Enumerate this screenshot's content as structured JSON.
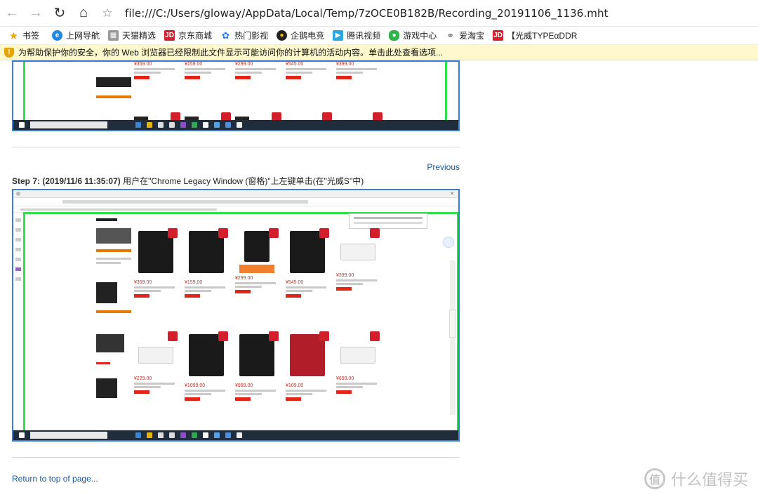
{
  "browser": {
    "url": "file:///C:/Users/gloway/AppData/Local/Temp/7zOCE0B182B/Recording_20191106_1136.mht",
    "back_icon": "back-arrow-icon",
    "forward_icon": "forward-arrow-icon",
    "refresh_icon": "refresh-icon",
    "home_icon": "home-icon",
    "favorite_icon": "star-icon"
  },
  "favorites": [
    {
      "label": "书签",
      "icon": "star-icon",
      "color": "#f2a900"
    },
    {
      "label": "上网导航",
      "icon": "ie-icon",
      "color": "#1e88e5"
    },
    {
      "label": "天猫精选",
      "icon": "tmall-icon",
      "color": "#777777"
    },
    {
      "label": "京东商城",
      "icon": "jd-icon",
      "color": "#d21f2b"
    },
    {
      "label": "热门影视",
      "icon": "paw-icon",
      "color": "#2a7be4"
    },
    {
      "label": "企鹅电竞",
      "icon": "penguin-icon",
      "color": "#222222"
    },
    {
      "label": "腾讯视频",
      "icon": "play-icon",
      "color": "#29a8e0"
    },
    {
      "label": "游戏中心",
      "icon": "gamepad-icon",
      "color": "#34b24a"
    },
    {
      "label": "爱淘宝",
      "icon": "globe-icon",
      "color": "#666666"
    },
    {
      "label": "【光威TYPEαDDR",
      "icon": "jd-icon",
      "color": "#d21f2b"
    }
  ],
  "infobar": {
    "text": "为帮助保护你的安全，你的 Web 浏览器已经限制此文件显示可能访问你的计算机的活动内容。单击此处查看选项..."
  },
  "steps": {
    "previous_label": "Previous",
    "step7_label": "Step 7: (2019/11/6 11:35:07)",
    "step7_text": "用户在\"Chrome Legacy Window (窗格)\"上左键单击(在\"光威S\"中)",
    "return_label": "Return to top of page..."
  },
  "products_row1_prices": [
    "¥359.00",
    "¥159.00",
    "¥299.00",
    "¥545.00",
    "¥399.00"
  ],
  "products_row2_prices": [
    "¥229.00",
    "¥1099.00",
    "¥999.00",
    "¥109.00",
    "¥699.00"
  ],
  "watermark": {
    "icon_text": "值",
    "text": "什么值得买"
  }
}
